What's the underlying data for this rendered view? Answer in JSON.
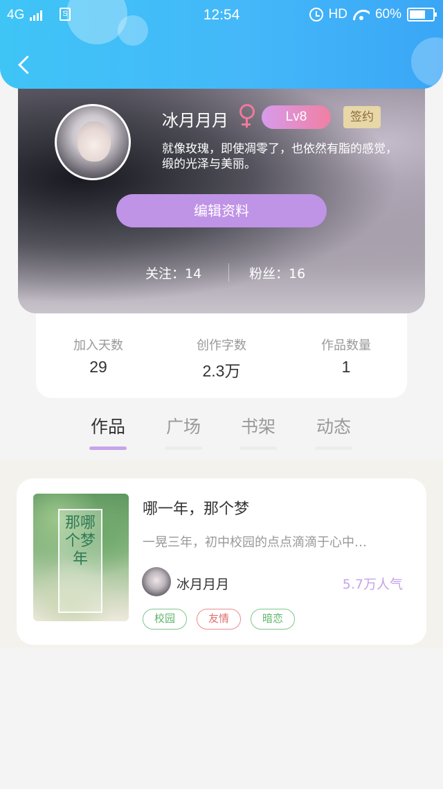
{
  "status_bar": {
    "network": "4G",
    "sim_label": "S",
    "time": "12:54",
    "hd": "HD",
    "battery": "60%"
  },
  "profile": {
    "name": "冰月月月",
    "gender_icon": "female-icon",
    "level": "Lv8",
    "sign_badge": "签约",
    "bio": "就像玫瑰，即使凋零了，也依然有脂的感觉，缎的光泽与美丽。",
    "edit_button": "编辑资料",
    "following_label": "关注：14",
    "fans_label": "粉丝：16"
  },
  "stats": [
    {
      "label": "加入天数",
      "value": "29"
    },
    {
      "label": "创作字数",
      "value": "2.3万"
    },
    {
      "label": "作品数量",
      "value": "1"
    }
  ],
  "tabs": [
    {
      "label": "作品",
      "active": true
    },
    {
      "label": "广场",
      "active": false
    },
    {
      "label": "书架",
      "active": false
    },
    {
      "label": "动态",
      "active": false
    }
  ],
  "book": {
    "cover_title": "那哪个梦年",
    "title": "哪一年，那个梦",
    "description": "一晃三年，初中校园的点点滴滴于心中…",
    "author": "冰月月月",
    "popularity": "5.7万人气",
    "tags": [
      {
        "label": "校园",
        "color": "green"
      },
      {
        "label": "友情",
        "color": "red"
      },
      {
        "label": "暗恋",
        "color": "green"
      }
    ]
  },
  "colors": {
    "header_blue": "#3fc4f6",
    "accent_purple": "#bf93e6",
    "tab_underline": "#c7a4ea",
    "popularity": "#c6a3ea"
  }
}
